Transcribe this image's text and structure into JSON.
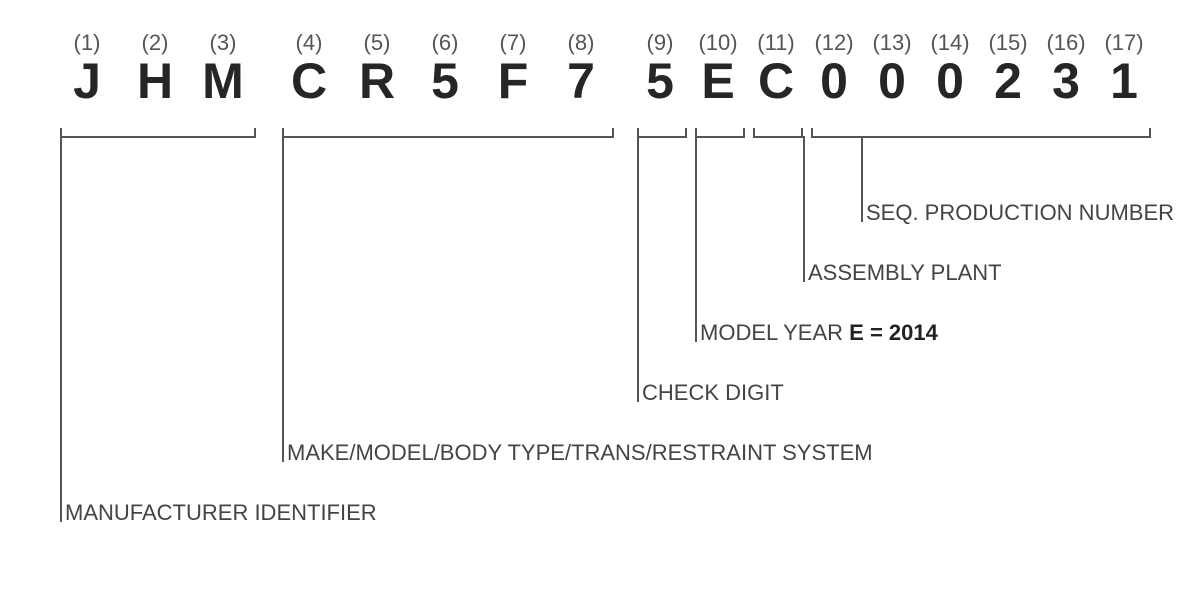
{
  "vin": {
    "slots": [
      {
        "idx": "(1)",
        "chr": "J"
      },
      {
        "idx": "(2)",
        "chr": "H"
      },
      {
        "idx": "(3)",
        "chr": "M"
      },
      {
        "idx": "(4)",
        "chr": "C"
      },
      {
        "idx": "(5)",
        "chr": "R"
      },
      {
        "idx": "(6)",
        "chr": "5"
      },
      {
        "idx": "(7)",
        "chr": "F"
      },
      {
        "idx": "(8)",
        "chr": "7"
      },
      {
        "idx": "(9)",
        "chr": "5"
      },
      {
        "idx": "(10)",
        "chr": "E"
      },
      {
        "idx": "(11)",
        "chr": "C"
      },
      {
        "idx": "(12)",
        "chr": "0"
      },
      {
        "idx": "(13)",
        "chr": "0"
      },
      {
        "idx": "(14)",
        "chr": "0"
      },
      {
        "idx": "(15)",
        "chr": "2"
      },
      {
        "idx": "(16)",
        "chr": "3"
      },
      {
        "idx": "(17)",
        "chr": "1"
      }
    ],
    "annotations": {
      "manufacturer": {
        "label": "MANUFACTURER IDENTIFIER"
      },
      "make_model": {
        "label": "MAKE/MODEL/BODY TYPE/TRANS/RESTRAINT SYSTEM"
      },
      "check_digit": {
        "label": "CHECK DIGIT"
      },
      "model_year": {
        "label_prefix": "MODEL YEAR ",
        "label_bold": "E = 2014"
      },
      "assembly_plant": {
        "label": "ASSEMBLY PLANT"
      },
      "production_number": {
        "label": "SEQ. PRODUCTION NUMBER"
      }
    }
  }
}
